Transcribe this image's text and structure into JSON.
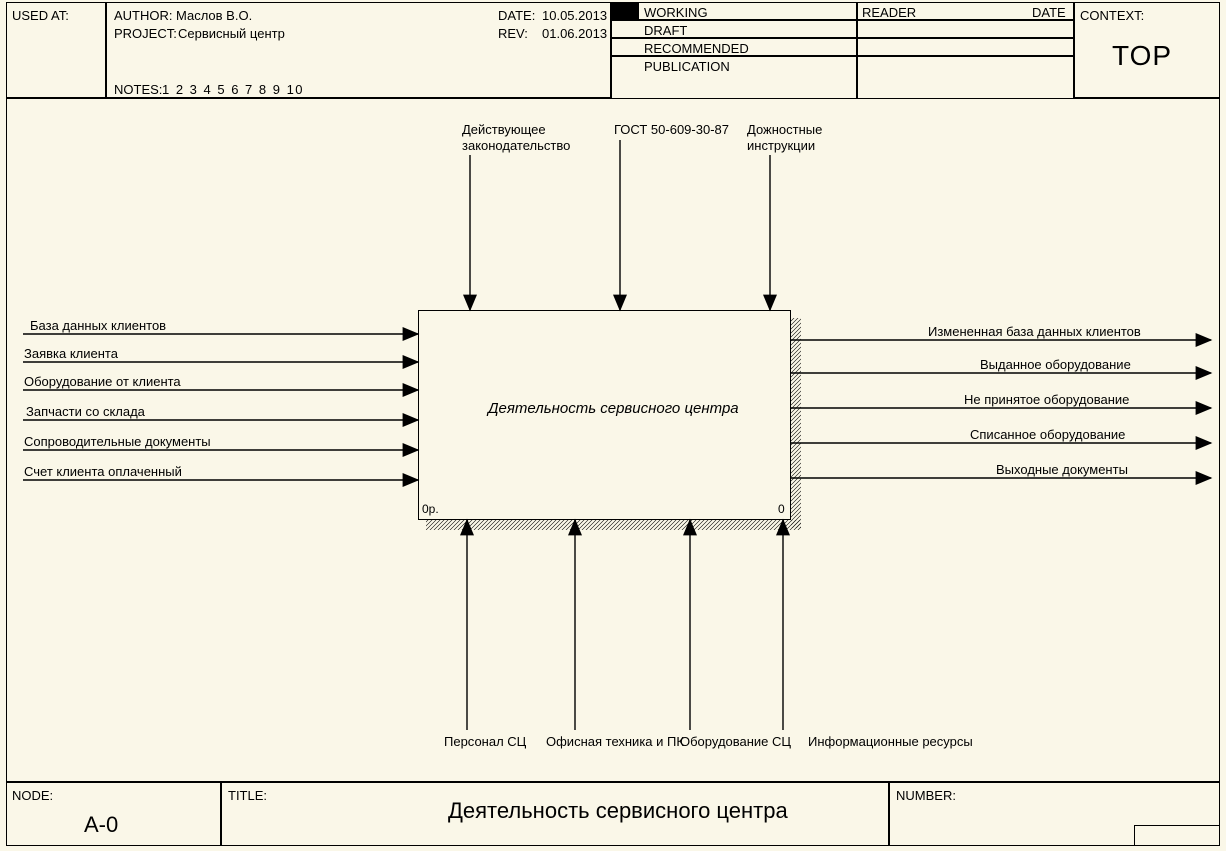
{
  "header": {
    "used_at": "USED AT:",
    "author_label": "AUTHOR:",
    "author": "Маслов В.О.",
    "project_label": "PROJECT:",
    "project": "Сервисный центр",
    "notes_label": "NOTES:",
    "notes": "1 2 3 4 5 6 7 8 9 10",
    "date_label": "DATE:",
    "date": "10.05.2013",
    "rev_label": "REV:",
    "rev": "01.06.2013",
    "working": "WORKING",
    "draft": "DRAFT",
    "recommended": "RECOMMENDED",
    "publication": "PUBLICATION",
    "reader": "READER",
    "reader_date": "DATE",
    "context": "CONTEXT:",
    "context_val": "TOP"
  },
  "controls": {
    "c1": "Действующее",
    "c1b": "законодательство",
    "c2": "ГОСТ 50-609-30-87",
    "c3": "Дожностные",
    "c3b": "инструкции"
  },
  "inputs": {
    "i1": "База данных клиентов",
    "i2": "Заявка клиента",
    "i3": "Оборудование от клиента",
    "i4": "Запчасти со склада",
    "i5": "Сопроводительные документы",
    "i6": "Счет клиента оплаченный"
  },
  "activity": {
    "name": "Деятельность сервисного центра",
    "cost": "0р.",
    "num": "0"
  },
  "outputs": {
    "o1": "Измененная база данных клиентов",
    "o2": "Выданное оборудование",
    "o3": "Не принятое оборудование",
    "o4": "Списанное оборудование",
    "o5": "Выходные документы"
  },
  "mechanisms": {
    "m1": "Персонал СЦ",
    "m2": "Офисная техника и ПК",
    "m3": "Оборудование СЦ",
    "m4": "Информационные ресурсы"
  },
  "footer": {
    "node_label": "NODE:",
    "node": "A-0",
    "title_label": "TITLE:",
    "title": "Деятельность сервисного центра",
    "number_label": "NUMBER:"
  }
}
